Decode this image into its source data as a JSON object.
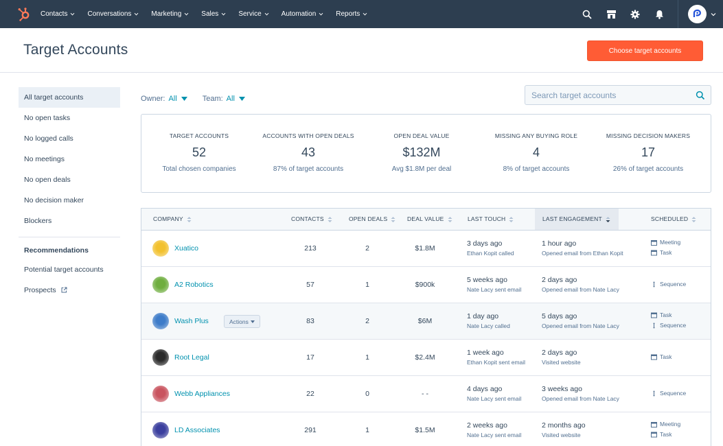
{
  "nav": {
    "items": [
      {
        "label": "Contacts"
      },
      {
        "label": "Conversations"
      },
      {
        "label": "Marketing"
      },
      {
        "label": "Sales"
      },
      {
        "label": "Service"
      },
      {
        "label": "Automation"
      },
      {
        "label": "Reports"
      }
    ],
    "brand_color": "#ff7a59"
  },
  "header": {
    "title": "Target Accounts",
    "primary_button": "Choose target accounts"
  },
  "sidebar": {
    "items": [
      {
        "label": "All target accounts",
        "active": true
      },
      {
        "label": "No open tasks"
      },
      {
        "label": "No logged calls"
      },
      {
        "label": "No meetings"
      },
      {
        "label": "No open deals"
      },
      {
        "label": "No decision maker"
      },
      {
        "label": "Blockers"
      }
    ],
    "recommendations_heading": "Recommendations",
    "recommendations": [
      {
        "label": "Potential target accounts"
      },
      {
        "label": "Prospects"
      }
    ]
  },
  "filters": {
    "owner_label": "Owner:",
    "owner_value": "All",
    "team_label": "Team:",
    "team_value": "All"
  },
  "search": {
    "placeholder": "Search target accounts"
  },
  "stats": [
    {
      "label": "TARGET ACCOUNTS",
      "value": "52",
      "sub": "Total chosen companies"
    },
    {
      "label": "ACCOUNTS WITH OPEN DEALS",
      "value": "43",
      "sub": "87% of target accounts"
    },
    {
      "label": "OPEN DEAL VALUE",
      "value": "$132M",
      "sub": "Avg $1.8M per deal"
    },
    {
      "label": "MISSING ANY BUYING ROLE",
      "value": "4",
      "sub": "8% of target accounts"
    },
    {
      "label": "MISSING DECISION MAKERS",
      "value": "17",
      "sub": "26% of target accounts"
    }
  ],
  "table": {
    "columns": {
      "company": "COMPANY",
      "contacts": "CONTACTS",
      "open_deals": "OPEN DEALS",
      "deal_value": "DEAL VALUE",
      "last_touch": "LAST TOUCH",
      "last_engagement": "LAST ENGAGEMENT",
      "scheduled": "SCHEDULED"
    },
    "actions_label": "Actions",
    "rows": [
      {
        "company": "Xuatico",
        "contacts": "213",
        "open_deals": "2",
        "deal_value": "$1.8M",
        "touch_time": "3 days ago",
        "touch_detail": "Ethan Kopit called",
        "engagement_time": "1 hour ago",
        "engagement_detail": "Opened email from Ethan Kopit",
        "scheduled": [
          "Meeting",
          "Task"
        ],
        "logo_color": "#f2c12e"
      },
      {
        "company": "A2 Robotics",
        "contacts": "57",
        "open_deals": "1",
        "deal_value": "$900k",
        "touch_time": "5 weeks ago",
        "touch_detail": "Nate Lacy sent email",
        "engagement_time": "2 days ago",
        "engagement_detail": "Opened email from Nate Lacy",
        "scheduled": [
          "Sequence"
        ],
        "logo_color": "#6fae3f"
      },
      {
        "company": "Wash Plus",
        "contacts": "83",
        "open_deals": "2",
        "deal_value": "$6M",
        "touch_time": "1 day ago",
        "touch_detail": "Nate Lacy called",
        "engagement_time": "5 days ago",
        "engagement_detail": "Opened email from Nate Lacy",
        "scheduled": [
          "Task",
          "Sequence"
        ],
        "logo_color": "#3e7cc9",
        "hover": true
      },
      {
        "company": "Root Legal",
        "contacts": "17",
        "open_deals": "1",
        "deal_value": "$2.4M",
        "touch_time": "1 week ago",
        "touch_detail": "Ethan Kopit sent email",
        "engagement_time": "2 days ago",
        "engagement_detail": "Visited website",
        "scheduled": [
          "Task"
        ],
        "logo_color": "#2b2b2b"
      },
      {
        "company": "Webb Appliances",
        "contacts": "22",
        "open_deals": "0",
        "deal_value": "- -",
        "touch_time": "4 days ago",
        "touch_detail": "Nate Lacy sent email",
        "engagement_time": "3 weeks ago",
        "engagement_detail": "Opened email from Nate Lacy",
        "scheduled": [
          "Sequence"
        ],
        "logo_color": "#c9545f"
      },
      {
        "company": "LD Associates",
        "contacts": "291",
        "open_deals": "1",
        "deal_value": "$1.5M",
        "touch_time": "2 weeks ago",
        "touch_detail": "Nate Lacy sent email",
        "engagement_time": "2 months ago",
        "engagement_detail": "Visited website",
        "scheduled": [
          "Meeting",
          "Task"
        ],
        "logo_color": "#3b3f9e"
      }
    ]
  }
}
